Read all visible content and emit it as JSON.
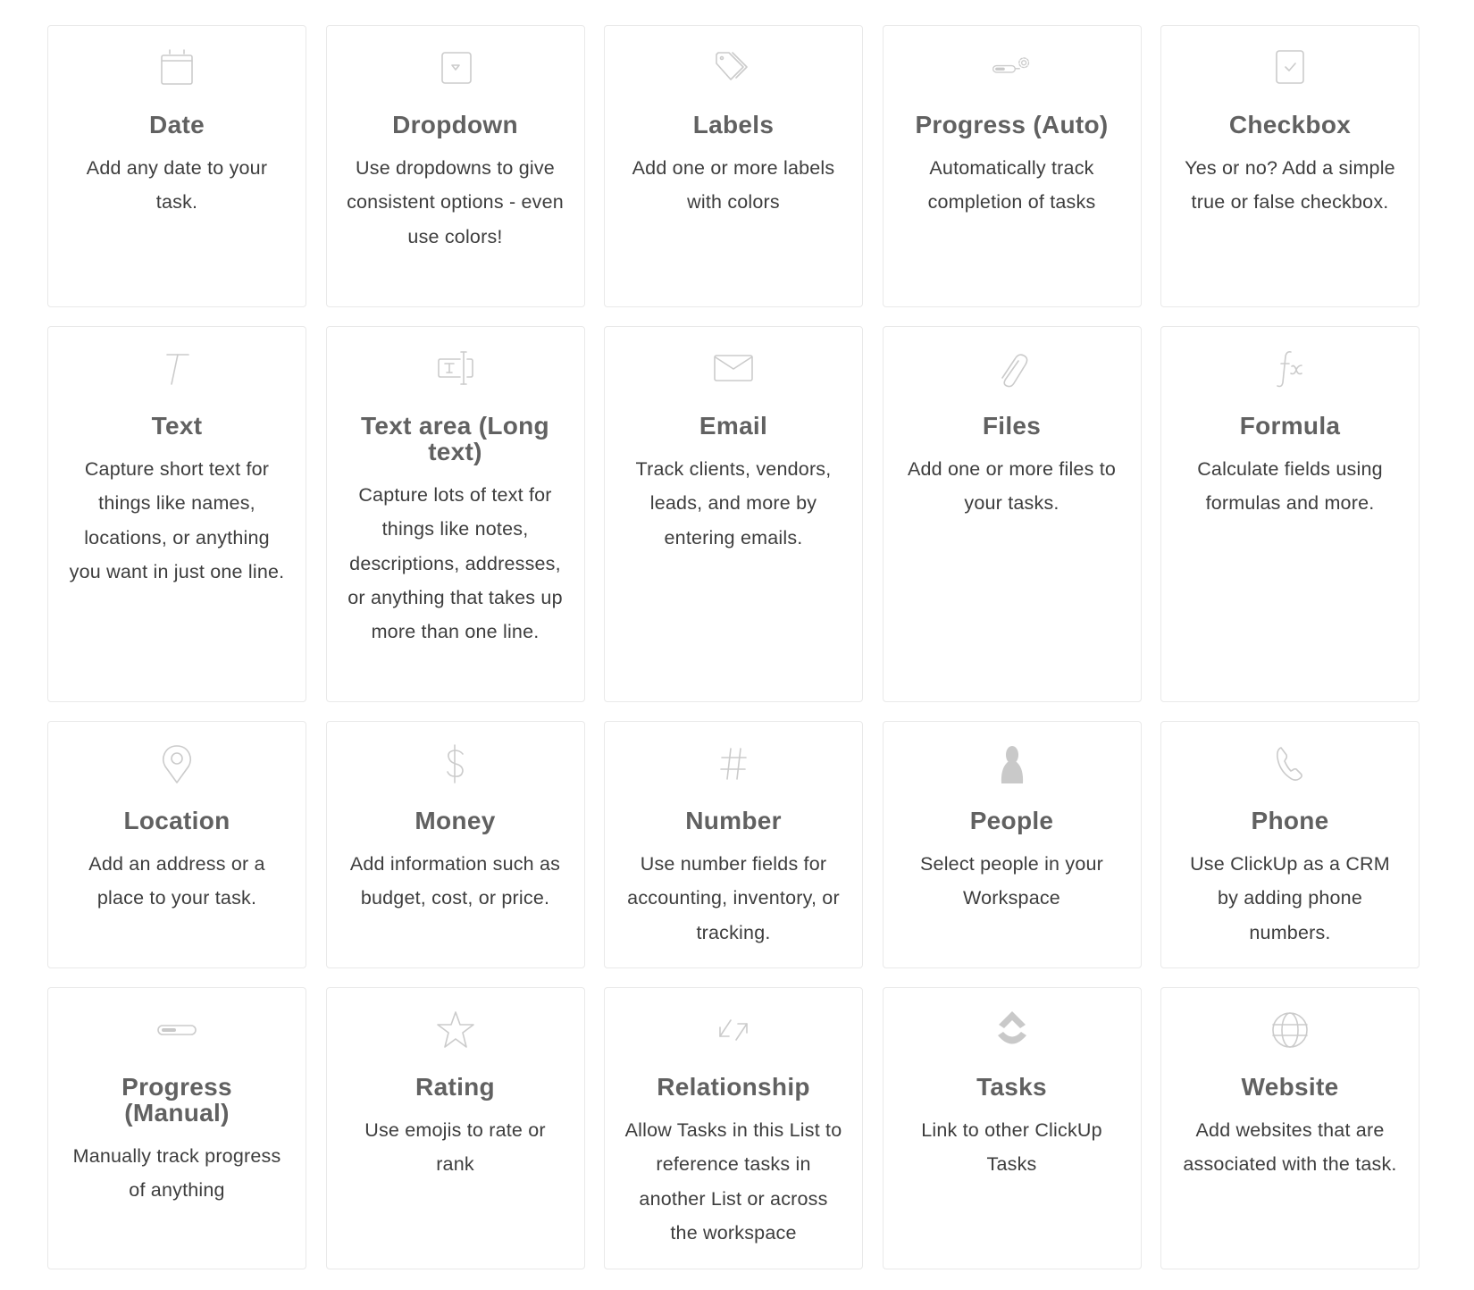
{
  "icon_color": "#cbcbcb",
  "title_color": "#616161",
  "description_color": "#3d3d3d",
  "card_border_color": "#e9e9e9",
  "field_types": [
    {
      "icon": "calendar-icon",
      "title": "Date",
      "description": "Add any date to your task."
    },
    {
      "icon": "dropdown-icon",
      "title": "Dropdown",
      "description": "Use dropdowns to give consistent options - even use colors!"
    },
    {
      "icon": "tag-icon",
      "title": "Labels",
      "description": "Add one or more labels with colors"
    },
    {
      "icon": "progress-auto-icon",
      "title": "Progress (Auto)",
      "description": "Automatically track completion of tasks"
    },
    {
      "icon": "checkbox-icon",
      "title": "Checkbox",
      "description": "Yes or no? Add a simple true or false checkbox."
    },
    {
      "icon": "text-icon",
      "title": "Text",
      "description": "Capture short text for things like names, locations, or anything you want in just one line."
    },
    {
      "icon": "text-area-icon",
      "title": "Text area (Long text)",
      "description": "Capture lots of text for things like notes, descriptions, addresses, or anything that takes up more than one line."
    },
    {
      "icon": "envelope-icon",
      "title": "Email",
      "description": "Track clients, vendors, leads, and more by entering emails."
    },
    {
      "icon": "paperclip-icon",
      "title": "Files",
      "description": "Add one or more files to your tasks."
    },
    {
      "icon": "formula-icon",
      "title": "Formula",
      "description": "Calculate fields using formulas and more."
    },
    {
      "icon": "map-pin-icon",
      "title": "Location",
      "description": "Add an address or a place to your task."
    },
    {
      "icon": "dollar-icon",
      "title": "Money",
      "description": "Add information such as budget, cost, or price."
    },
    {
      "icon": "hash-icon",
      "title": "Number",
      "description": "Use number fields for accounting, inventory, or tracking."
    },
    {
      "icon": "person-icon",
      "title": "People",
      "description": "Select people in your Workspace"
    },
    {
      "icon": "phone-icon",
      "title": "Phone",
      "description": "Use ClickUp as a CRM by adding phone numbers."
    },
    {
      "icon": "progress-manual-icon",
      "title": "Progress (Manual)",
      "description": "Manually track progress of anything"
    },
    {
      "icon": "star-icon",
      "title": "Rating",
      "description": "Use emojis to rate or rank"
    },
    {
      "icon": "relationship-arrows-icon",
      "title": "Relationship",
      "description": "Allow Tasks in this List to reference tasks in another List or across the workspace"
    },
    {
      "icon": "clickup-logo-icon",
      "title": "Tasks",
      "description": "Link to other ClickUp Tasks"
    },
    {
      "icon": "globe-icon",
      "title": "Website",
      "description": "Add websites that are associated with the task."
    }
  ]
}
